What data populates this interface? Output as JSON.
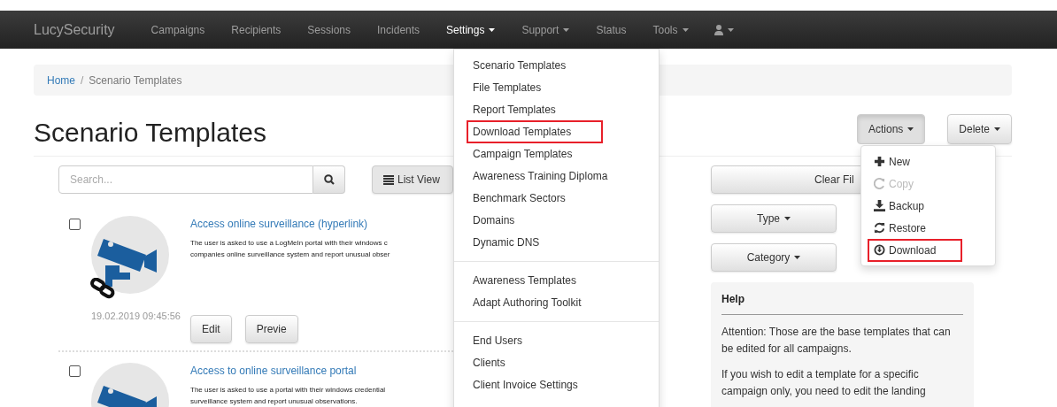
{
  "navbar": {
    "brand": "LucySecurity",
    "items": [
      {
        "kind": "text",
        "label": "Campaigns",
        "caret": false,
        "active": false
      },
      {
        "kind": "text",
        "label": "Recipients",
        "caret": false,
        "active": false
      },
      {
        "kind": "text",
        "label": "Sessions",
        "caret": false,
        "active": false
      },
      {
        "kind": "text",
        "label": "Incidents",
        "caret": false,
        "active": false
      },
      {
        "kind": "text",
        "label": "Settings",
        "caret": true,
        "active": true
      },
      {
        "kind": "text",
        "label": "Support",
        "caret": true,
        "active": false
      },
      {
        "kind": "text",
        "label": "Status",
        "caret": false,
        "active": false
      },
      {
        "kind": "text",
        "label": "Tools",
        "caret": true,
        "active": false
      },
      {
        "kind": "user",
        "caret": true,
        "active": false
      }
    ]
  },
  "breadcrumb": [
    {
      "label": "Home",
      "link": true
    },
    {
      "label": "Scenario Templates",
      "link": false
    }
  ],
  "breadcrumb_separator": "/",
  "title": "Scenario Templates",
  "header_buttons": [
    {
      "label": "Actions",
      "pressed": true
    },
    {
      "label": "Delete",
      "pressed": false
    }
  ],
  "search": {
    "placeholder": "Search..."
  },
  "view_button": "List View",
  "templates": [
    {
      "title": "Access online surveillance (hyperlink)",
      "checked": false,
      "linked": true,
      "description": [
        "The user is asked to use a LogMeIn portal with their windows c",
        "companies online surveillance system and report unusual obser"
      ],
      "date": "19.02.2019 09:45:56",
      "buttons": [
        "Edit",
        "Previe"
      ]
    },
    {
      "title": "Access to online surveillance portal",
      "checked": false,
      "linked": false,
      "description": [
        "The user is asked to use a portal with their windows credential",
        "surveillance system and report unusual observations."
      ]
    }
  ],
  "filters": {
    "clear": "Clear Fil",
    "dropdowns": [
      "Type",
      "Category"
    ]
  },
  "help": {
    "title": "Help",
    "paragraphs": [
      "Attention: Those are the base templates that can be edited for all campaigns.",
      "If you wish to edit a template for a specific campaign only, you need to edit the landing"
    ]
  },
  "settings_menu": [
    [
      {
        "label": "Scenario Templates",
        "highlighted": false
      },
      {
        "label": "File Templates",
        "highlighted": false
      },
      {
        "label": "Report Templates",
        "highlighted": false
      },
      {
        "label": "Download Templates",
        "highlighted": true
      },
      {
        "label": "Campaign Templates",
        "highlighted": false
      },
      {
        "label": "Awareness Training Diploma",
        "highlighted": false
      },
      {
        "label": "Benchmark Sectors",
        "highlighted": false
      },
      {
        "label": "Domains",
        "highlighted": false
      },
      {
        "label": "Dynamic DNS",
        "highlighted": false
      }
    ],
    [
      {
        "label": "Awareness Templates",
        "highlighted": false
      },
      {
        "label": "Adapt Authoring Toolkit",
        "highlighted": false
      }
    ],
    [
      {
        "label": "End Users",
        "highlighted": false
      },
      {
        "label": "Clients",
        "highlighted": false
      },
      {
        "label": "Client Invoice Settings",
        "highlighted": false
      }
    ]
  ],
  "actions_menu": [
    {
      "kind": "new",
      "label": "New",
      "disabled": false,
      "highlighted": false
    },
    {
      "kind": "copy",
      "label": "Copy",
      "disabled": true,
      "highlighted": false
    },
    {
      "kind": "backup",
      "label": "Backup",
      "disabled": false,
      "highlighted": false
    },
    {
      "kind": "restore",
      "label": "Restore",
      "disabled": false,
      "highlighted": false
    },
    {
      "kind": "download",
      "label": "Download",
      "disabled": false,
      "highlighted": true
    }
  ]
}
